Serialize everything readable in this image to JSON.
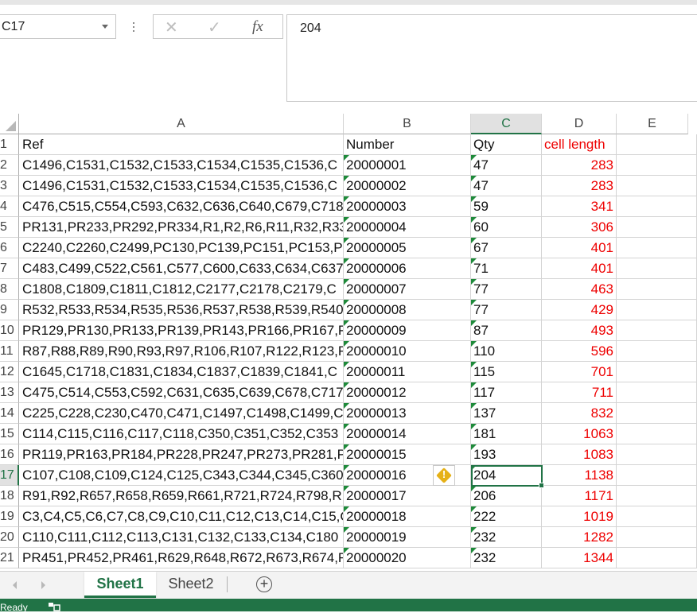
{
  "namebox": {
    "value": "C17"
  },
  "formula_bar": {
    "value": "204",
    "fx_label": "fx",
    "cancel": "✕",
    "enter": "✓"
  },
  "columns": [
    "A",
    "B",
    "C",
    "D",
    "E"
  ],
  "header_row": {
    "row": "1",
    "a": "Ref",
    "b": "Number",
    "c": "Qty",
    "d": "cell length"
  },
  "rows": [
    {
      "row": "2",
      "a": "C1496,C1531,C1532,C1533,C1534,C1535,C1536,C",
      "b": "20000001",
      "c": "47",
      "d": "283"
    },
    {
      "row": "3",
      "a": "C1496,C1531,C1532,C1533,C1534,C1535,C1536,C",
      "b": "20000002",
      "c": "47",
      "d": "283"
    },
    {
      "row": "4",
      "a": "C476,C515,C554,C593,C632,C636,C640,C679,C718",
      "b": "20000003",
      "c": "59",
      "d": "341"
    },
    {
      "row": "5",
      "a": "PR131,PR233,PR292,PR334,R1,R2,R6,R11,R32,R33",
      "b": "20000004",
      "c": "60",
      "d": "306"
    },
    {
      "row": "6",
      "a": "C2240,C2260,C2499,PC130,PC139,PC151,PC153,P",
      "b": "20000005",
      "c": "67",
      "d": "401"
    },
    {
      "row": "7",
      "a": "C483,C499,C522,C561,C577,C600,C633,C634,C637",
      "b": "20000006",
      "c": "71",
      "d": "401"
    },
    {
      "row": "8",
      "a": "C1808,C1809,C1811,C1812,C2177,C2178,C2179,C",
      "b": "20000007",
      "c": "77",
      "d": "463"
    },
    {
      "row": "9",
      "a": "R532,R533,R534,R535,R536,R537,R538,R539,R540",
      "b": "20000008",
      "c": "77",
      "d": "429"
    },
    {
      "row": "10",
      "a": "PR129,PR130,PR133,PR139,PR143,PR166,PR167,P",
      "b": "20000009",
      "c": "87",
      "d": "493"
    },
    {
      "row": "11",
      "a": "R87,R88,R89,R90,R93,R97,R106,R107,R122,R123,R",
      "b": "20000010",
      "c": "110",
      "d": "596"
    },
    {
      "row": "12",
      "a": "C1645,C1718,C1831,C1834,C1837,C1839,C1841,C",
      "b": "20000011",
      "c": "115",
      "d": "701"
    },
    {
      "row": "13",
      "a": "C475,C514,C553,C592,C631,C635,C639,C678,C717",
      "b": "20000012",
      "c": "117",
      "d": "711"
    },
    {
      "row": "14",
      "a": "C225,C228,C230,C470,C471,C1497,C1498,C1499,C",
      "b": "20000013",
      "c": "137",
      "d": "832"
    },
    {
      "row": "15",
      "a": "C114,C115,C116,C117,C118,C350,C351,C352,C353",
      "b": "20000014",
      "c": "181",
      "d": "1063"
    },
    {
      "row": "16",
      "a": "PR119,PR163,PR184,PR228,PR247,PR273,PR281,P",
      "b": "20000015",
      "c": "193",
      "d": "1083"
    },
    {
      "row": "17",
      "a": "C107,C108,C109,C124,C125,C343,C344,C345,C360",
      "b": "20000016",
      "c": "204",
      "d": "1138"
    },
    {
      "row": "18",
      "a": "R91,R92,R657,R658,R659,R661,R721,R724,R798,R",
      "b": "20000017",
      "c": "206",
      "d": "1171"
    },
    {
      "row": "19",
      "a": "C3,C4,C5,C6,C7,C8,C9,C10,C11,C12,C13,C14,C15,C",
      "b": "20000018",
      "c": "222",
      "d": "1019"
    },
    {
      "row": "20",
      "a": "C110,C111,C112,C113,C131,C132,C133,C134,C180",
      "b": "20000019",
      "c": "232",
      "d": "1282"
    },
    {
      "row": "21",
      "a": "PR451,PR452,PR461,R629,R648,R672,R673,R674,R",
      "b": "20000020",
      "c": "232",
      "d": "1344"
    }
  ],
  "warning_icon": "!",
  "sheets": [
    {
      "label": "Sheet1",
      "active": true
    },
    {
      "label": "Sheet2",
      "active": false
    }
  ],
  "add_sheet_label": "+",
  "status_bar": {
    "text": "Ready"
  },
  "colors": {
    "accent": "#217346",
    "length_text": "#ee0000",
    "error_triangle": "#1e8a3a"
  }
}
